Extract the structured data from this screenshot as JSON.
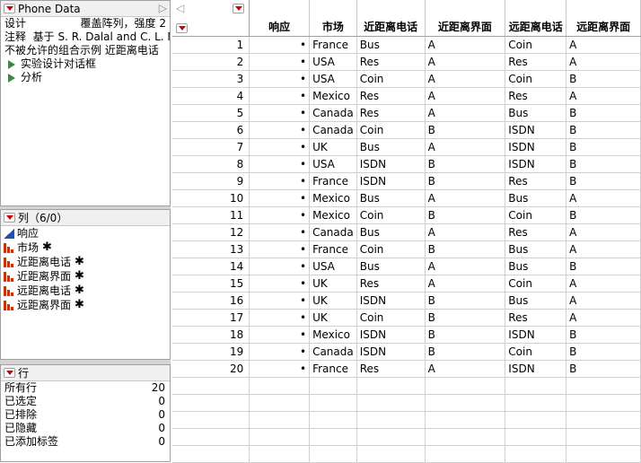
{
  "table_panel": {
    "title": "Phone Data",
    "lines": [
      {
        "label": "设计",
        "value": "覆盖阵列，强度 2"
      },
      {
        "label": "注释",
        "value": "基于 S. R. Dalal and C. L. M"
      },
      {
        "label": "",
        "value": "不被允许的组合示例  近距离电话"
      }
    ],
    "scripts": [
      "实验设计对话框",
      "分析"
    ]
  },
  "columns_panel": {
    "title": "列（6/0）",
    "items": [
      {
        "name": "响应",
        "type": "continuous",
        "locked": false
      },
      {
        "name": "市场",
        "type": "nominal",
        "locked": true
      },
      {
        "name": "近距离电话",
        "type": "nominal",
        "locked": true
      },
      {
        "name": "近距离界面",
        "type": "nominal",
        "locked": true
      },
      {
        "name": "远距离电话",
        "type": "nominal",
        "locked": true
      },
      {
        "name": "远距离界面",
        "type": "nominal",
        "locked": true
      }
    ]
  },
  "rows_panel": {
    "title": "行",
    "stats": [
      {
        "label": "所有行",
        "value": "20"
      },
      {
        "label": "已选定",
        "value": "0"
      },
      {
        "label": "已排除",
        "value": "0"
      },
      {
        "label": "已隐藏",
        "value": "0"
      },
      {
        "label": "已添加标签",
        "value": "0"
      }
    ]
  },
  "grid": {
    "headers": [
      "响应",
      "市场",
      "近距离电话",
      "近距离界面",
      "远距离电话",
      "远距离界面"
    ],
    "rows": [
      [
        "1",
        "•",
        "France",
        "Bus",
        "A",
        "Coin",
        "A"
      ],
      [
        "2",
        "•",
        "USA",
        "Res",
        "A",
        "Res",
        "A"
      ],
      [
        "3",
        "•",
        "USA",
        "Coin",
        "A",
        "Coin",
        "B"
      ],
      [
        "4",
        "•",
        "Mexico",
        "Res",
        "A",
        "Res",
        "A"
      ],
      [
        "5",
        "•",
        "Canada",
        "Res",
        "A",
        "Bus",
        "B"
      ],
      [
        "6",
        "•",
        "Canada",
        "Coin",
        "B",
        "ISDN",
        "B"
      ],
      [
        "7",
        "•",
        "UK",
        "Bus",
        "A",
        "ISDN",
        "B"
      ],
      [
        "8",
        "•",
        "USA",
        "ISDN",
        "B",
        "ISDN",
        "B"
      ],
      [
        "9",
        "•",
        "France",
        "ISDN",
        "B",
        "Res",
        "B"
      ],
      [
        "10",
        "•",
        "Mexico",
        "Bus",
        "A",
        "Bus",
        "A"
      ],
      [
        "11",
        "•",
        "Mexico",
        "Coin",
        "B",
        "Coin",
        "B"
      ],
      [
        "12",
        "•",
        "Canada",
        "Bus",
        "A",
        "Res",
        "A"
      ],
      [
        "13",
        "•",
        "France",
        "Coin",
        "B",
        "Bus",
        "A"
      ],
      [
        "14",
        "•",
        "USA",
        "Bus",
        "A",
        "Bus",
        "B"
      ],
      [
        "15",
        "•",
        "UK",
        "Res",
        "A",
        "Coin",
        "A"
      ],
      [
        "16",
        "•",
        "UK",
        "ISDN",
        "B",
        "Bus",
        "A"
      ],
      [
        "17",
        "•",
        "UK",
        "Coin",
        "B",
        "Res",
        "A"
      ],
      [
        "18",
        "•",
        "Mexico",
        "ISDN",
        "B",
        "ISDN",
        "B"
      ],
      [
        "19",
        "•",
        "Canada",
        "ISDN",
        "B",
        "Coin",
        "B"
      ],
      [
        "20",
        "•",
        "France",
        "Res",
        "A",
        "ISDN",
        "B"
      ]
    ]
  }
}
